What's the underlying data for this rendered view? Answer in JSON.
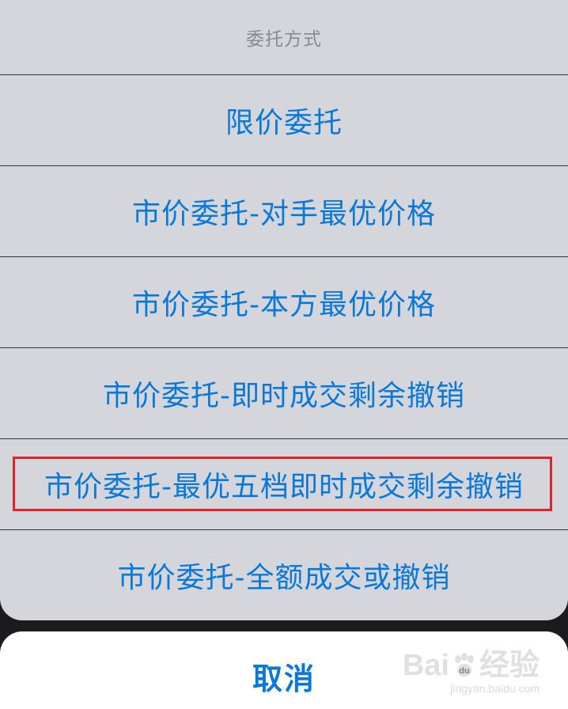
{
  "sheet": {
    "title": "委托方式",
    "options": [
      "限价委托",
      "市价委托-对手最优价格",
      "市价委托-本方最优价格",
      "市价委托-即时成交剩余撤销",
      "市价委托-最优五档即时成交剩余撤销",
      "市价委托-全额成交或撤销"
    ],
    "highlighted_option_index": 4
  },
  "cancel": {
    "label": "取消"
  },
  "watermark": {
    "brand_left": "Bai",
    "brand_right": "经验",
    "url": "jingyan.baidu.com"
  },
  "colors": {
    "accent": "#0a78d8",
    "sheet_bg": "#d5d6db",
    "highlight": "#e0222b",
    "title": "#8a8a8e"
  }
}
